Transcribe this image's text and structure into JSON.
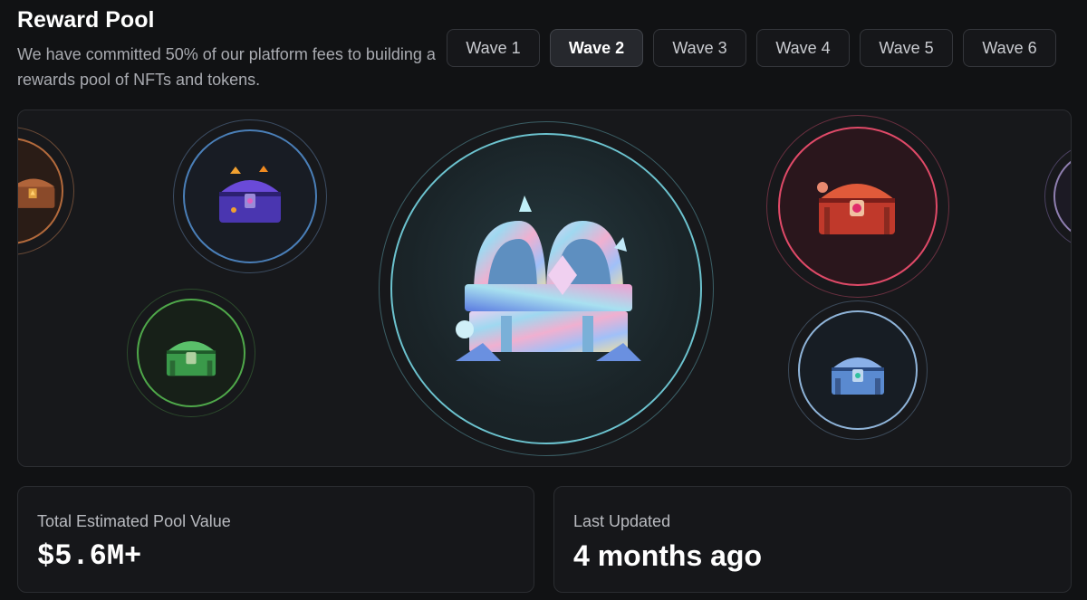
{
  "header": {
    "title": "Reward Pool",
    "subtitle": "We have committed 50% of our platform fees to building a rewards pool of NFTs and tokens."
  },
  "waves": [
    {
      "label": "Wave 1",
      "active": false
    },
    {
      "label": "Wave 2",
      "active": true
    },
    {
      "label": "Wave 3",
      "active": false
    },
    {
      "label": "Wave 4",
      "active": false
    },
    {
      "label": "Wave 5",
      "active": false
    },
    {
      "label": "Wave 6",
      "active": false
    }
  ],
  "chests": [
    {
      "name": "bronze-chest-icon",
      "tier": "bronze",
      "ring_color": "#b36a3c"
    },
    {
      "name": "purple-chest-icon",
      "tier": "purple",
      "ring_color": "#4a7fb8"
    },
    {
      "name": "green-chest-icon",
      "tier": "green",
      "ring_color": "#4fa84a"
    },
    {
      "name": "holographic-chest-icon",
      "tier": "holographic",
      "ring_color": "#6cc3cf"
    },
    {
      "name": "red-chest-icon",
      "tier": "red",
      "ring_color": "#e04a68"
    },
    {
      "name": "blue-chest-icon",
      "tier": "blue",
      "ring_color": "#8fb4d9"
    },
    {
      "name": "violet-chest-icon",
      "tier": "violet",
      "ring_color": "#8f7fb0"
    }
  ],
  "stats": {
    "pool_value_label": "Total Estimated Pool Value",
    "pool_value": "$5.6M+",
    "updated_label": "Last Updated",
    "updated_value": "4 months ago"
  }
}
